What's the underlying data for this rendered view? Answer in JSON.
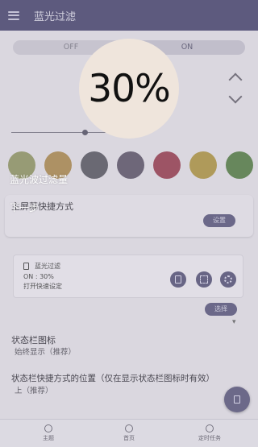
{
  "app": {
    "title": "蓝光过滤"
  },
  "filter_toggle": {
    "off_label": "OFF",
    "on_label": "ON",
    "selected": "ON"
  },
  "filter_level": {
    "value": "30%",
    "fraction": 0.3
  },
  "swatches": [
    {
      "name": "olive",
      "color": "#9ea277"
    },
    {
      "name": "amber",
      "color": "#b69764"
    },
    {
      "name": "gray",
      "color": "#6d6c75"
    },
    {
      "name": "mauve",
      "color": "#716a7b"
    },
    {
      "name": "red",
      "color": "#a45565"
    },
    {
      "name": "yellow",
      "color": "#b8a15a"
    },
    {
      "name": "green",
      "color": "#6a8c5c"
    }
  ],
  "shortcut_section": {
    "title": "主屏幕快捷方式",
    "settings_button": "设置"
  },
  "notification_preview": {
    "title": "蓝光过滤",
    "status": "ON : 30%",
    "hint": "打开快速设定",
    "actions_icons": [
      "phone-icon",
      "expand-icon",
      "gear-icon"
    ]
  },
  "select_button": "选择",
  "status_bar_icon": {
    "label": "状态栏图标",
    "value": "始终显示（推荐）"
  },
  "shortcut_position": {
    "label": "状态栏快捷方式的位置（仅在显示状态栏图标时有效）",
    "value": "上（推荐）"
  },
  "bottom_nav": [
    {
      "label": "主题",
      "icon": "theme-icon"
    },
    {
      "label": "首页",
      "icon": "home-icon"
    },
    {
      "label": "定时任务",
      "icon": "timer-icon"
    }
  ],
  "overlay": {
    "guide_text": "蓝光波过滤量",
    "next_text": "下一步"
  },
  "colors": {
    "accent": "#5f5c80",
    "bubble": "#efe5dc"
  }
}
